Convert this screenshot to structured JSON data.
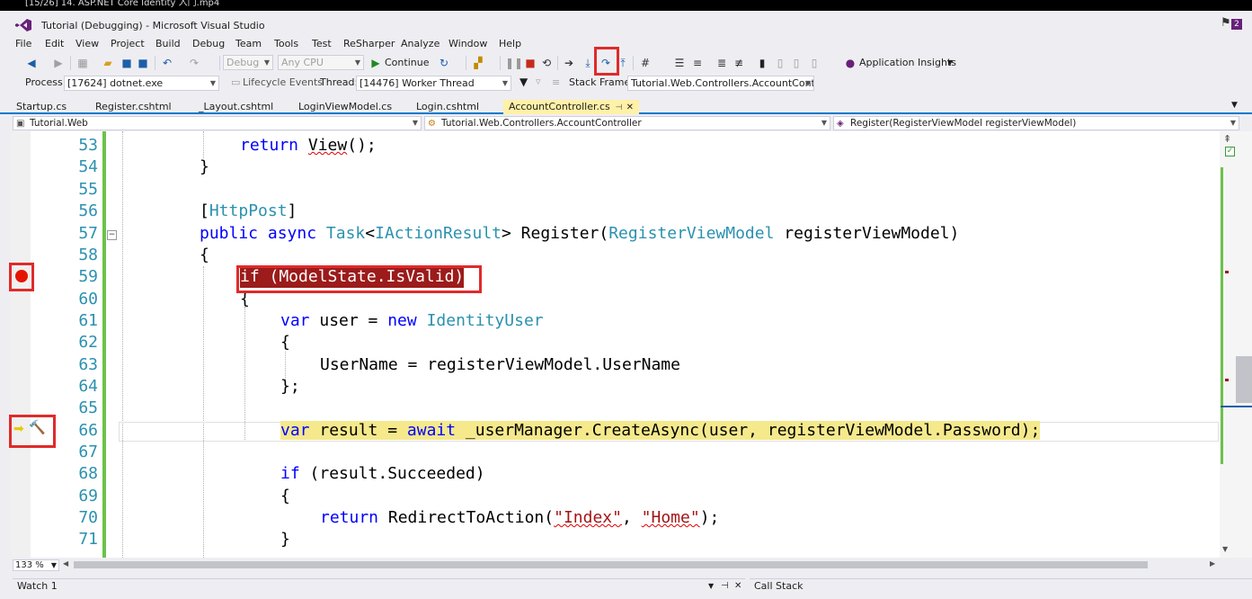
{
  "video_title": "[15/26] 14. ASP.NET Core Identity 入门.mp4",
  "window": {
    "title": "Tutorial (Debugging) - Microsoft Visual Studio",
    "notification_count": "2"
  },
  "menu": [
    "File",
    "Edit",
    "View",
    "Project",
    "Build",
    "Debug",
    "Team",
    "Tools",
    "Test",
    "ReSharper",
    "Analyze",
    "Window",
    "Help"
  ],
  "toolbar": {
    "config": "Debug",
    "platform": "Any CPU",
    "continue_label": "Continue",
    "app_insights_label": "Application Insights"
  },
  "debug_location": {
    "process_label": "Process:",
    "process_value": "[17624] dotnet.exe",
    "lifecycle_label": "Lifecycle Events",
    "thread_label": "Thread:",
    "thread_value": "[14476] Worker Thread",
    "stack_frame_label": "Stack Frame:",
    "stack_frame_value": "Tutorial.Web.Controllers.AccountControll"
  },
  "tabs": [
    "Startup.cs",
    "Register.cshtml",
    "_Layout.cshtml",
    "LoginViewModel.cs",
    "Login.cshtml",
    "AccountController.cs"
  ],
  "active_tab": "AccountController.cs",
  "navbar": {
    "project": "Tutorial.Web",
    "class": "Tutorial.Web.Controllers.AccountController",
    "member": "Register(RegisterViewModel registerViewModel)"
  },
  "code_lines": {
    "53": "return View();",
    "54": "}",
    "55": "",
    "56": "[HttpPost]",
    "57": "public async Task<IActionResult> Register(RegisterViewModel registerViewModel)",
    "58": "{",
    "59": "if (ModelState.IsValid)",
    "60": "{",
    "61": "var user = new IdentityUser",
    "62": "{",
    "63": "UserName = registerViewModel.UserName",
    "64": "};",
    "65": "",
    "66": "var result = await _userManager.CreateAsync(user, registerViewModel.Password);",
    "67": "",
    "68": "if (result.Succeeded)",
    "69": "{",
    "70": "return RedirectToAction(\"Index\", \"Home\");",
    "71": "}"
  },
  "line_numbers": [
    "53",
    "54",
    "55",
    "56",
    "57",
    "58",
    "59",
    "60",
    "61",
    "62",
    "63",
    "64",
    "65",
    "66",
    "67",
    "68",
    "69",
    "70",
    "71"
  ],
  "zoom": "133 %",
  "bottom_panels": {
    "watch": "Watch 1",
    "callstack": "Call Stack"
  },
  "colors": {
    "accent": "#007acc",
    "breakpoint": "#e51400",
    "annotation": "#e02a2a",
    "exec_line": "#f5e98c"
  }
}
